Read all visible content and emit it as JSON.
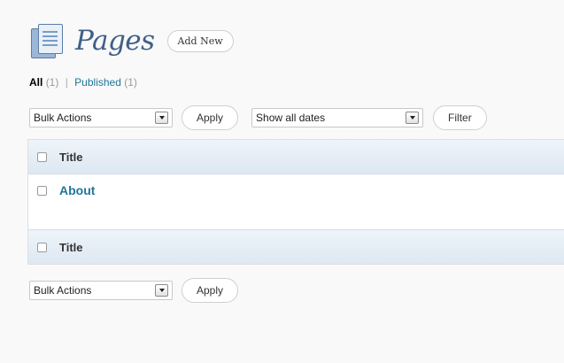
{
  "header": {
    "title": "Pages",
    "add_new_label": "Add New",
    "icon": "pages-icon"
  },
  "filters": {
    "all_label": "All",
    "all_count": "(1)",
    "separator": "|",
    "published_label": "Published",
    "published_count": "(1)"
  },
  "top_nav": {
    "bulk_actions": "Bulk Actions",
    "apply_label": "Apply",
    "dates_select": "Show all dates",
    "filter_label": "Filter"
  },
  "table": {
    "header_title": "Title",
    "rows": [
      {
        "title": "About"
      }
    ],
    "footer_title": "Title"
  },
  "bottom_nav": {
    "bulk_actions": "Bulk Actions",
    "apply_label": "Apply"
  },
  "colors": {
    "link": "#21759b",
    "title": "#3f5f87",
    "header_bg": "#e4edf6"
  }
}
